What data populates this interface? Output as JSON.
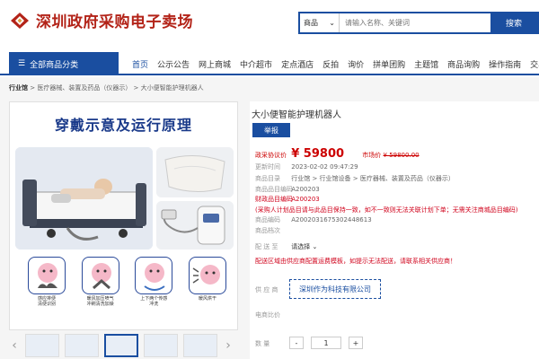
{
  "header": {
    "logo_text": "深圳政府采购电子卖场",
    "search_category": "商品",
    "search_placeholder": "请输入名称、关键词",
    "search_button": "搜索"
  },
  "nav": {
    "category_button": "全部商品分类",
    "items": [
      "首页",
      "公示公告",
      "网上商城",
      "中介超市",
      "定点酒店",
      "反拍",
      "询价",
      "拼单团购",
      "主题馆",
      "商品询购",
      "操作指南",
      "交易"
    ]
  },
  "breadcrumb": {
    "root": "行业馆",
    "path": " > 医疗器械、装置及药品（仪器示） > 大小便智能护理机器人"
  },
  "gallery": {
    "poster_title": "穿戴示意及运行原理",
    "icon_captions": [
      "感应排便\n清便识别",
      "暖风加压喷气\n冲刷清洗加燥",
      "上下两个传感\n冲洗",
      "暖风烘干"
    ]
  },
  "product": {
    "title": "大小便智能护理机器人",
    "report_button": "举报",
    "price_label": "政采协议价",
    "price": "¥ 59800",
    "market_label": "市场价",
    "market_price": "¥ 59800.00",
    "updated_label": "更新时间",
    "updated_value": "2023-02-02 09:47:29",
    "category_label": "商品目录",
    "category_value": "行业馆 > 行业馆设备 > 医疗器械、装置及药品（仪器示）",
    "item_code_label": "商品品目编码",
    "item_code_value": "A200203",
    "fin_code_label": "财政品目编码",
    "fin_code_value": "A200203",
    "warning_text": "(采购人计划品目请与此品目保持一致，如不一致则无法关联计划下单；无需关注商城品目编码)",
    "goods_code_label": "商品编码",
    "goods_code_value": "A2002031675302448613",
    "archive_label": "商品档次",
    "delivery_label": "配 送 至",
    "delivery_value": "请选择",
    "delivery_warning": "配送区域由供应商配置运费模板，如提示无法配送，请联系相关供应商！",
    "supplier_label": "供 应 商",
    "supplier_value": "深圳作为科技有限公司",
    "compare_label": "电商比价",
    "qty_label": "数 量",
    "qty_minus": "-",
    "qty_value": "1",
    "qty_plus": "+"
  },
  "colors": {
    "brand_blue": "#1a4ea0",
    "price_red": "#cc0000",
    "logo_red": "#b32318"
  }
}
